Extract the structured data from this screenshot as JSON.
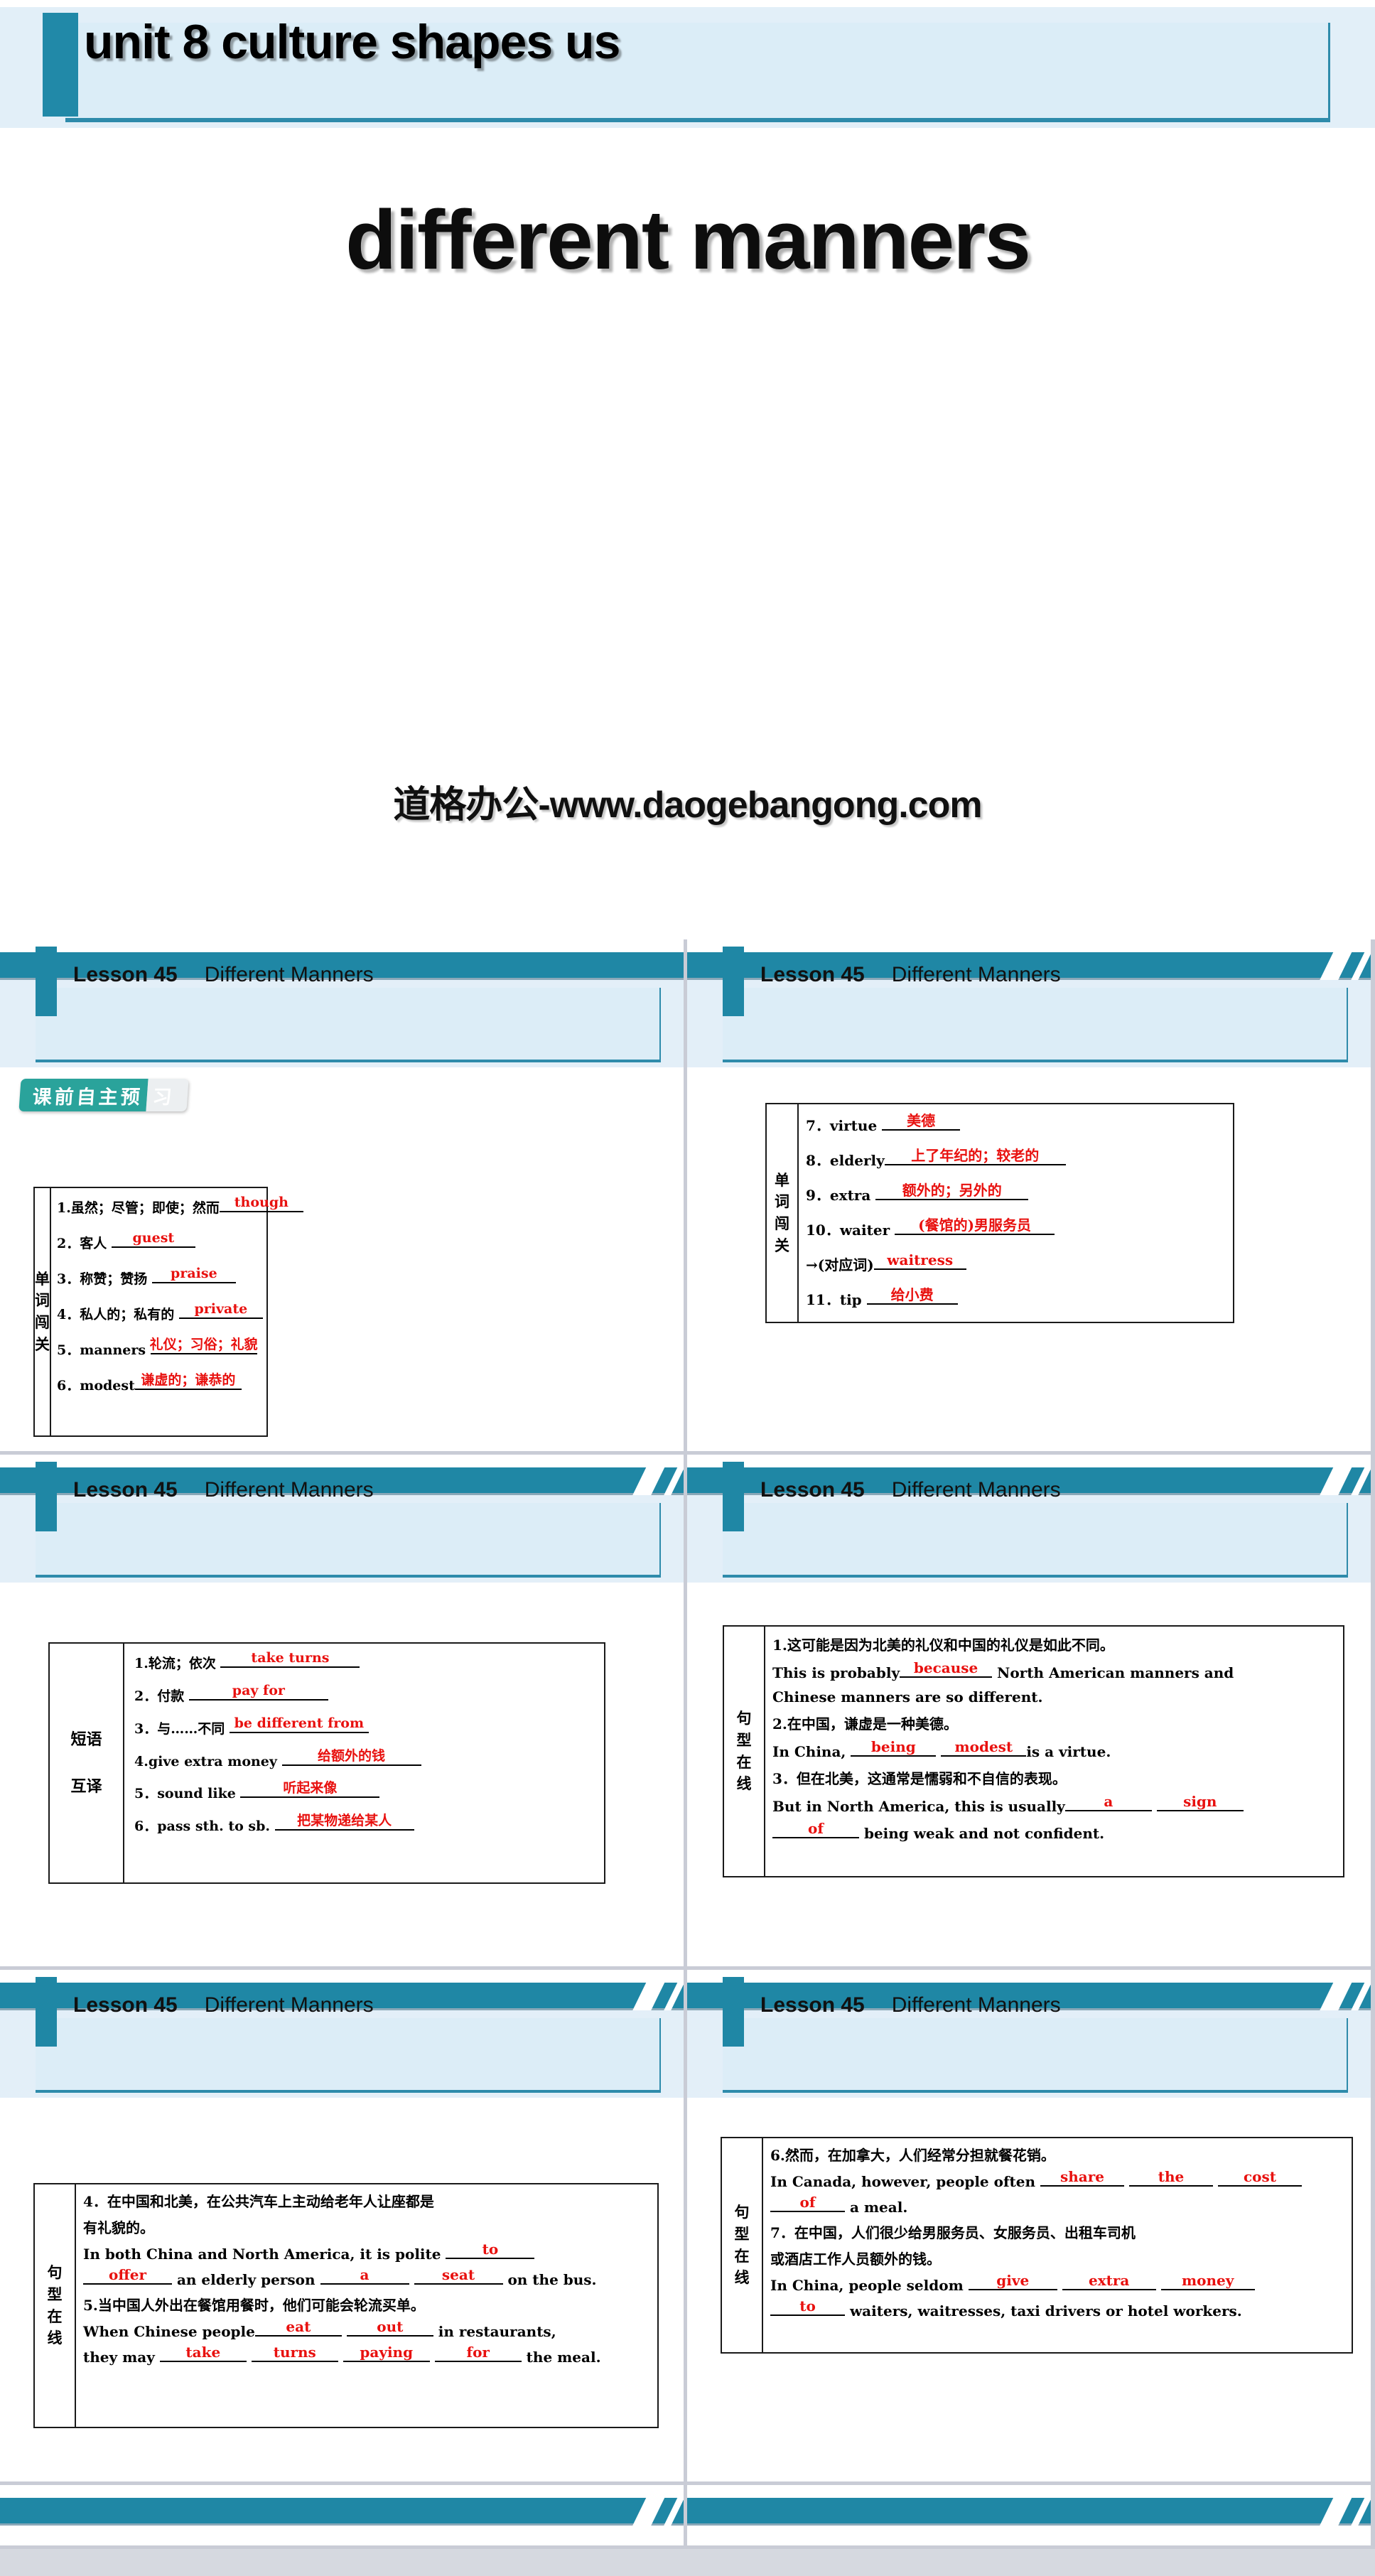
{
  "colors": {
    "teal": "#1f87a5",
    "teal_dark": "#2e8bab",
    "header_band": "#e3eff8",
    "answer_red": "#e8110f",
    "badge_teal": "#2aa39b",
    "page_bg": "#d6d9e0"
  },
  "title_slide": {
    "unit_label": "unit 8   culture shapes us",
    "main_title": "different manners",
    "watermark": "道格办公-www.daogebangong.com"
  },
  "header": {
    "lesson": "Lesson 45",
    "lesson_title": "Different Manners"
  },
  "slides": [
    {
      "id": "vocab-1",
      "badge": {
        "text_main": "课前自主预",
        "text_tail": "习"
      },
      "side_label": [
        "单",
        "词",
        "闯",
        "关"
      ],
      "rows": [
        {
          "num": "1.",
          "prompt": "虽然；尽管；即使；然而",
          "answer": "though",
          "line_w": 118
        },
        {
          "num": "2．",
          "prompt": "客人 ",
          "answer": "guest",
          "line_w": 118
        },
        {
          "num": "3．",
          "prompt": "称赞；赞扬 ",
          "answer": "praise",
          "line_w": 118
        },
        {
          "num": "4．",
          "prompt": "私人的；私有的 ",
          "answer": "private",
          "line_w": 118
        },
        {
          "num": "5．",
          "prompt": "manners ",
          "answer": "礼仪；习俗；礼貌",
          "line_w": 150
        },
        {
          "num": "6．",
          "prompt": "modest",
          "answer": "谦虚的；谦恭的",
          "line_w": 150
        }
      ]
    },
    {
      "id": "vocab-2",
      "side_label": [
        "单",
        "词",
        "闯",
        "关"
      ],
      "rows": [
        {
          "num": "7．",
          "prompt": "virtue ",
          "answer": "美德",
          "line_w": 110
        },
        {
          "num": "8．",
          "prompt": "elderly",
          "answer": "上了年纪的；较老的",
          "line_w": 255
        },
        {
          "num": "9．",
          "prompt": "extra ",
          "answer": "额外的；另外的",
          "line_w": 215
        },
        {
          "num": "10．",
          "prompt": "waiter ",
          "answer": "(餐馆的)男服务员",
          "line_w": 225
        },
        {
          "num": "",
          "prompt": "→(对应词)",
          "answer": "waitress",
          "line_w": 130
        },
        {
          "num": "11．",
          "prompt": "tip ",
          "answer": "给小费",
          "line_w": 128
        }
      ]
    },
    {
      "id": "phrases",
      "side_label": [
        "短语",
        "互译"
      ],
      "rows": [
        {
          "num": "1.",
          "prompt": "轮流；依次 ",
          "answer": "take turns",
          "line_w": 196
        },
        {
          "num": "2．",
          "prompt": "付款 ",
          "answer": "pay for",
          "line_w": 196
        },
        {
          "num": "3．",
          "prompt": "与……不同 ",
          "answer": "be different from",
          "line_w": 196
        },
        {
          "num": "4.",
          "prompt": "give extra money ",
          "answer": "给额外的钱",
          "line_w": 196
        },
        {
          "num": "5．",
          "prompt": "sound like ",
          "answer": "听起来像",
          "line_w": 196
        },
        {
          "num": "6．",
          "prompt": "pass sth. to sb. ",
          "answer": "把某物递给某人",
          "line_w": 196
        }
      ]
    },
    {
      "id": "sentences-1",
      "side_label": [
        "句",
        "型",
        "在",
        "线"
      ],
      "items": [
        {
          "num": "1.",
          "cn": "这可能是因为北美的礼仪和中国的礼仪是如此不同。",
          "en_parts": [
            {
              "t": "text",
              "v": "This is probably"
            },
            {
              "t": "blank",
              "v": "because",
              "w": 130
            },
            {
              "t": "text",
              "v": " North American manners and"
            }
          ],
          "en_line2": "Chinese manners are so different."
        },
        {
          "num": "2.",
          "cn": "在中国，谦虚是一种美德。",
          "en_parts": [
            {
              "t": "text",
              "v": "In China, "
            },
            {
              "t": "blank",
              "v": "being",
              "w": 120
            },
            {
              "t": "text",
              "v": " "
            },
            {
              "t": "blank",
              "v": "modest",
              "w": 120
            },
            {
              "t": "text",
              "v": "is a virtue."
            }
          ]
        },
        {
          "num": "3．",
          "cn": "但在北美，这通常是懦弱和不自信的表现。",
          "en_parts": [
            {
              "t": "text",
              "v": "But in North America, this is usually"
            },
            {
              "t": "blank",
              "v": "a",
              "w": 122
            },
            {
              "t": "text",
              "v": " "
            },
            {
              "t": "blank",
              "v": "sign",
              "w": 122
            }
          ],
          "en_parts2": [
            {
              "t": "blank",
              "v": "of",
              "w": 122
            },
            {
              "t": "text",
              "v": " being weak and not confident."
            }
          ]
        }
      ]
    },
    {
      "id": "sentences-2",
      "side_label": [
        "句",
        "型",
        "在",
        "线"
      ],
      "items": [
        {
          "num": "4．",
          "cn": "在中国和北美，在公共汽车上主动给老年人让座都是",
          "cn2": "有礼貌的。",
          "en_parts": [
            {
              "t": "text",
              "v": "In both China and North America, it is polite "
            },
            {
              "t": "blank",
              "v": "to",
              "w": 125
            }
          ],
          "en_parts2": [
            {
              "t": "blank",
              "v": "offer",
              "w": 125
            },
            {
              "t": "text",
              "v": " an elderly person "
            },
            {
              "t": "blank",
              "v": "a",
              "w": 125
            },
            {
              "t": "text",
              "v": " "
            },
            {
              "t": "blank",
              "v": "seat",
              "w": 125
            },
            {
              "t": "text",
              "v": " on the bus."
            }
          ]
        },
        {
          "num": "5.",
          "cn": "当中国人外出在餐馆用餐时，他们可能会轮流买单。",
          "en_parts": [
            {
              "t": "text",
              "v": "When Chinese people"
            },
            {
              "t": "blank",
              "v": "eat",
              "w": 122
            },
            {
              "t": "text",
              "v": " "
            },
            {
              "t": "blank",
              "v": "out",
              "w": 122
            },
            {
              "t": "text",
              "v": " in restaurants,"
            }
          ],
          "en_parts2": [
            {
              "t": "text",
              "v": "they may "
            },
            {
              "t": "blank",
              "v": "take",
              "w": 122
            },
            {
              "t": "text",
              "v": " "
            },
            {
              "t": "blank",
              "v": "turns",
              "w": 122
            },
            {
              "t": "text",
              "v": " "
            },
            {
              "t": "blank",
              "v": "paying",
              "w": 122
            },
            {
              "t": "text",
              "v": " "
            },
            {
              "t": "blank",
              "v": "for",
              "w": 122
            },
            {
              "t": "text",
              "v": " the meal."
            }
          ]
        }
      ]
    },
    {
      "id": "sentences-3",
      "side_label": [
        "句",
        "型",
        "在",
        "线"
      ],
      "items": [
        {
          "num": "6.",
          "cn": "然而，在加拿大，人们经常分担就餐花销。",
          "en_parts": [
            {
              "t": "text",
              "v": "In Canada, however, people often "
            },
            {
              "t": "blank",
              "v": "share",
              "w": 118
            },
            {
              "t": "text",
              "v": " "
            },
            {
              "t": "blank",
              "v": "the",
              "w": 118
            },
            {
              "t": "text",
              "v": " "
            },
            {
              "t": "blank",
              "v": "cost",
              "w": 118
            }
          ],
          "en_parts2": [
            {
              "t": "blank",
              "v": "of",
              "w": 105
            },
            {
              "t": "text",
              "v": " a meal."
            }
          ]
        },
        {
          "num": "7．",
          "cn": "在中国，人们很少给男服务员、女服务员、出租车司机",
          "cn2": "或酒店工作人员额外的钱。",
          "en_parts": [
            {
              "t": "text",
              "v": "In China, people seldom "
            },
            {
              "t": "blank",
              "v": "give",
              "w": 125
            },
            {
              "t": "text",
              "v": " "
            },
            {
              "t": "blank",
              "v": "extra",
              "w": 132
            },
            {
              "t": "text",
              "v": " "
            },
            {
              "t": "blank",
              "v": "money",
              "w": 132
            }
          ],
          "en_parts2": [
            {
              "t": "blank",
              "v": "to",
              "w": 105
            },
            {
              "t": "text",
              "v": " waiters, waitresses, taxi drivers or hotel workers."
            }
          ]
        }
      ]
    }
  ]
}
